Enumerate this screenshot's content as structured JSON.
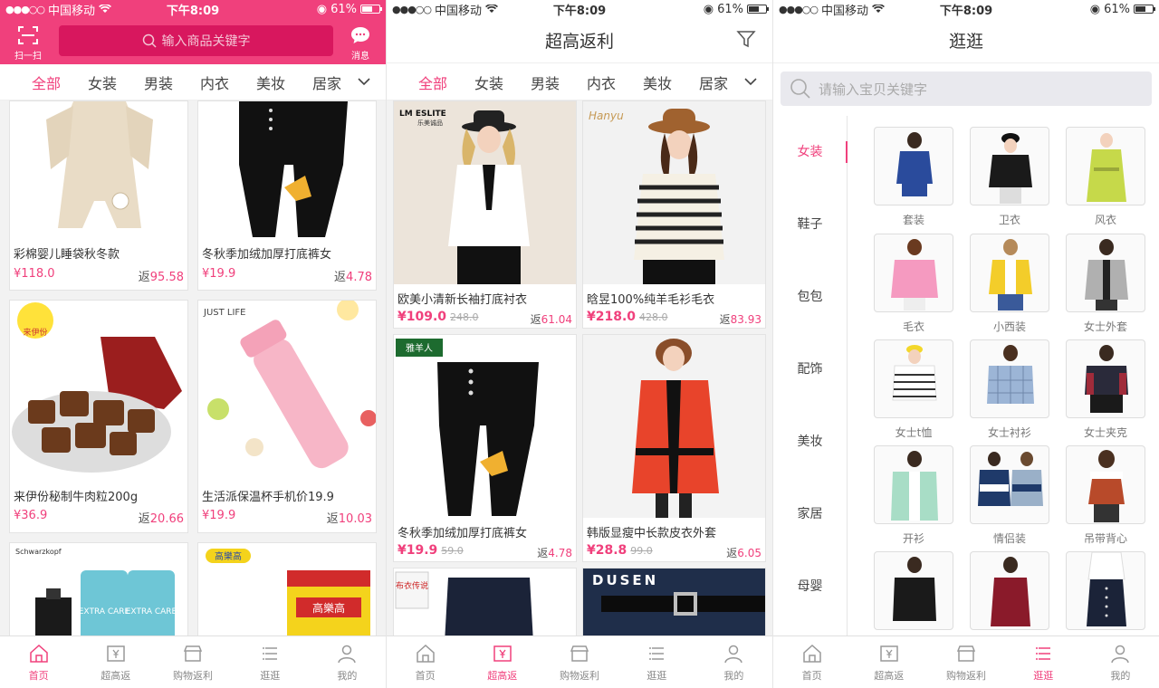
{
  "colors": {
    "accent": "#f0407c",
    "accent_dark": "#d8175e"
  },
  "status": {
    "carrier": "中国移动",
    "time": "下午8:09",
    "battery": "61%"
  },
  "screen1": {
    "scan_label": "扫一扫",
    "search_placeholder": "输入商品关键字",
    "message_label": "消息",
    "categories": [
      "全部",
      "女装",
      "男装",
      "内衣",
      "美妆",
      "居家"
    ],
    "products": [
      {
        "title": "彩棉婴儿睡袋秋冬款",
        "price": "¥118.0",
        "rebate_prefix": "返",
        "rebate": "95.58"
      },
      {
        "title": "冬秋季加绒加厚打底裤女",
        "price": "¥19.9",
        "rebate_prefix": "返",
        "rebate": "4.78"
      },
      {
        "title": "来伊份秘制牛肉粒200g",
        "price": "¥36.9",
        "rebate_prefix": "返",
        "rebate": "20.66"
      },
      {
        "title": "生活派保温杯手机价19.9",
        "price": "¥19.9",
        "rebate_prefix": "返",
        "rebate": "10.03"
      },
      {
        "title": "",
        "price": "",
        "rebate_prefix": "",
        "rebate": ""
      },
      {
        "title": "",
        "price": "",
        "rebate_prefix": "",
        "rebate": ""
      }
    ],
    "brand_labels": [
      "JUST LIFE",
      "来伊份",
      "Schwarzkopf",
      "EXTRA CARE",
      "EXTRA CARE",
      "高樂高",
      "高樂高"
    ]
  },
  "screen2": {
    "title": "超高返利",
    "categories": [
      "全部",
      "女装",
      "男装",
      "内衣",
      "美妆",
      "居家"
    ],
    "products": [
      {
        "title": "欧美小清新长袖打底衬衣",
        "price": "¥109.0",
        "orig": "248.0",
        "rebate_prefix": "返",
        "rebate": "61.04"
      },
      {
        "title": "晗昱100%纯羊毛衫毛衣",
        "price": "¥218.0",
        "orig": "428.0",
        "rebate_prefix": "返",
        "rebate": "83.93"
      },
      {
        "title": "冬秋季加绒加厚打底裤女",
        "price": "¥19.9",
        "orig": "59.0",
        "rebate_prefix": "返",
        "rebate": "4.78"
      },
      {
        "title": "韩版显瘦中长款皮衣外套",
        "price": "¥28.8",
        "orig": "99.0",
        "rebate_prefix": "返",
        "rebate": "6.05"
      }
    ],
    "brand_labels": [
      "乐美诚品",
      "LM ESLITE",
      "Hanyu",
      "雅羊人",
      "布衣传说",
      "DUSEN"
    ]
  },
  "screen3": {
    "title": "逛逛",
    "search_placeholder": "请输入宝贝关键字",
    "sidebar": [
      "女装",
      "鞋子",
      "包包",
      "配饰",
      "美妆",
      "家居",
      "母婴"
    ],
    "subcategories": [
      "套装",
      "卫衣",
      "风衣",
      "毛衣",
      "小西装",
      "女士外套",
      "女士t恤",
      "女士衬衫",
      "女士夹克",
      "开衫",
      "情侣装",
      "吊带背心",
      "",
      "",
      ""
    ]
  },
  "tabbar": [
    "首页",
    "超高返",
    "购物返利",
    "逛逛",
    "我的"
  ]
}
